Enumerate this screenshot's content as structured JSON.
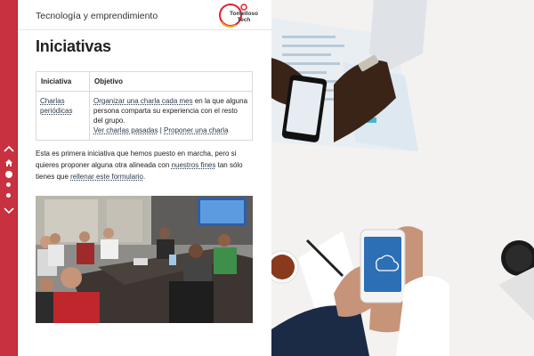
{
  "header": {
    "site_title": "Tecnología y emprendimiento",
    "logo_line1": "Tomelloso",
    "logo_line2": "Tech"
  },
  "page": {
    "title": "Iniciativas"
  },
  "table": {
    "headers": [
      "Iniciativa",
      "Objetivo"
    ],
    "row": {
      "name_line1": "Charlas",
      "name_line2": "periódicas",
      "objective_link": "Organizar una charla cada mes",
      "objective_text": " en la que alguna persona comparta su experiencia con el resto del grupo.",
      "link_past": "Ver charlas pasadas",
      "separator": " | ",
      "link_propose": "Proponer una charla"
    }
  },
  "paragraph": {
    "text1": "Esta es primera iniciativa que hemos puesto en marcha, pero si quieres proponer alguna otra alineada con ",
    "link_aims": "nuestros fines",
    "text2": " tan sólo tienes que ",
    "link_form": "rellenar este formulario",
    "text3": "."
  },
  "sidebar": {
    "icons": [
      "chevron-up-icon",
      "home-icon",
      "dot-active",
      "dot",
      "dot",
      "chevron-down-icon"
    ]
  },
  "colors": {
    "sidebar": "#c8313f",
    "logo_ring": "#e4202e",
    "logo_accent": "#f4a51c"
  }
}
